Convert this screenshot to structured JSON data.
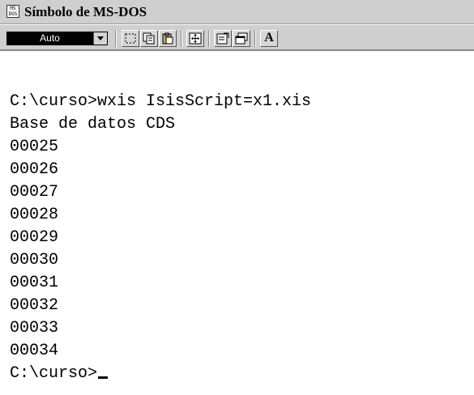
{
  "window": {
    "title": "Símbolo de MS-DOS",
    "icon_text_top": "MS",
    "icon_text_bottom": "DOS"
  },
  "toolbar": {
    "font_size_value": "Auto",
    "letter_button": "A",
    "buttons": [
      {
        "name": "mark-icon"
      },
      {
        "name": "copy-icon"
      },
      {
        "name": "paste-icon"
      },
      {
        "name": "fullscreen-icon"
      },
      {
        "name": "properties-icon"
      },
      {
        "name": "background-icon"
      },
      {
        "name": "font-icon"
      }
    ]
  },
  "console": {
    "lines": [
      "",
      "C:\\curso>wxis IsisScript=x1.xis",
      "Base de datos CDS",
      "00025",
      "00026",
      "00027",
      "00028",
      "00029",
      "00030",
      "00031",
      "00032",
      "00033",
      "00034"
    ],
    "prompt": "C:\\curso>"
  }
}
